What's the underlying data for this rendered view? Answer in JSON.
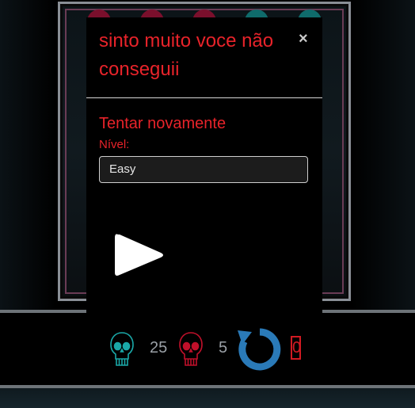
{
  "modal": {
    "title": "sinto muito voce não conseguii",
    "close_symbol": "×",
    "retry_text": "Tentar novamente",
    "level_label": "Nível:",
    "level_selected": "Easy"
  },
  "hud": {
    "cyan_count": "25",
    "red_count": "5",
    "score": "0"
  },
  "colors": {
    "accent_red": "#e8232a",
    "skull_cyan": "#1aa8a8",
    "skull_red": "#c0102a",
    "reload_blue": "#2a7ab8"
  },
  "icons": {
    "close": "close-icon",
    "play": "play-icon",
    "skull_cyan": "skull-icon",
    "skull_red": "skull-icon",
    "reload": "reload-icon"
  }
}
